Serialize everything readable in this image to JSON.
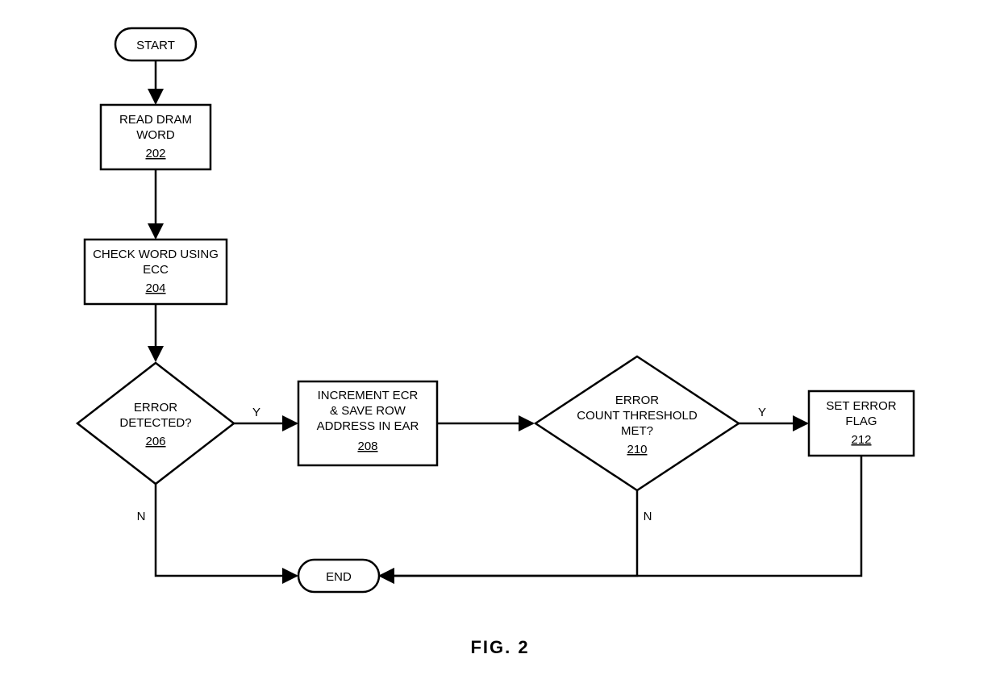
{
  "figure_label": "FIG. 2",
  "terminals": {
    "start": "START",
    "end": "END"
  },
  "nodes": {
    "read_dram": {
      "line1": "READ DRAM",
      "line2": "WORD",
      "ref": "202"
    },
    "check_word": {
      "line1": "CHECK WORD USING",
      "line2": "ECC",
      "ref": "204"
    },
    "error_detected": {
      "line1": "ERROR",
      "line2": "DETECTED?",
      "ref": "206"
    },
    "increment_ecr": {
      "line1": "INCREMENT ECR",
      "line2": "& SAVE ROW",
      "line3": "ADDRESS IN EAR",
      "ref": "208"
    },
    "threshold": {
      "line1": "ERROR",
      "line2": "COUNT THRESHOLD",
      "line3": "MET?",
      "ref": "210"
    },
    "set_flag": {
      "line1": "SET ERROR",
      "line2": "FLAG",
      "ref": "212"
    }
  },
  "edges": {
    "yes": "Y",
    "no": "N"
  }
}
